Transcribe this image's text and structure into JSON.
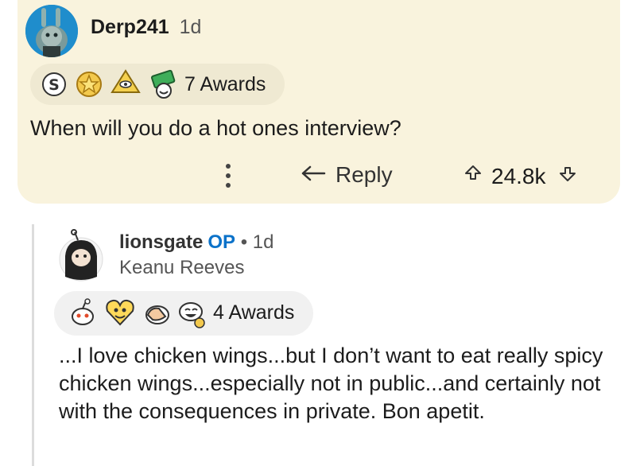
{
  "comment": {
    "username": "Derp241",
    "age": "1d",
    "awards_label": "7 Awards",
    "body": "When will you do a hot ones interview?",
    "reply_label": "Reply",
    "score": "24.8k"
  },
  "reply": {
    "username": "lionsgate",
    "op_badge": "OP",
    "separator": "•",
    "age": "1d",
    "flair": "Keanu Reeves",
    "awards_label": "4 Awards",
    "body": "...I love chicken wings...but I don’t want to eat really spicy chicken wings...especially not in public...and certainly not with the consequences in private. Bon apetit."
  },
  "icons": {
    "comment_awards": [
      "silver-s-award-icon",
      "gold-star-award-icon",
      "eye-pyramid-award-icon",
      "money-award-icon"
    ],
    "reply_awards": [
      "snoo-award-icon",
      "heart-face-award-icon",
      "facepalm-award-icon",
      "laughing-award-icon"
    ],
    "actions": [
      "more-options-icon",
      "reply-arrow-icon",
      "upvote-icon",
      "downvote-icon"
    ]
  },
  "colors": {
    "comment_bg": "#f9f3dd",
    "op_badge": "#0b72c9",
    "text": "#1c1c1c"
  }
}
